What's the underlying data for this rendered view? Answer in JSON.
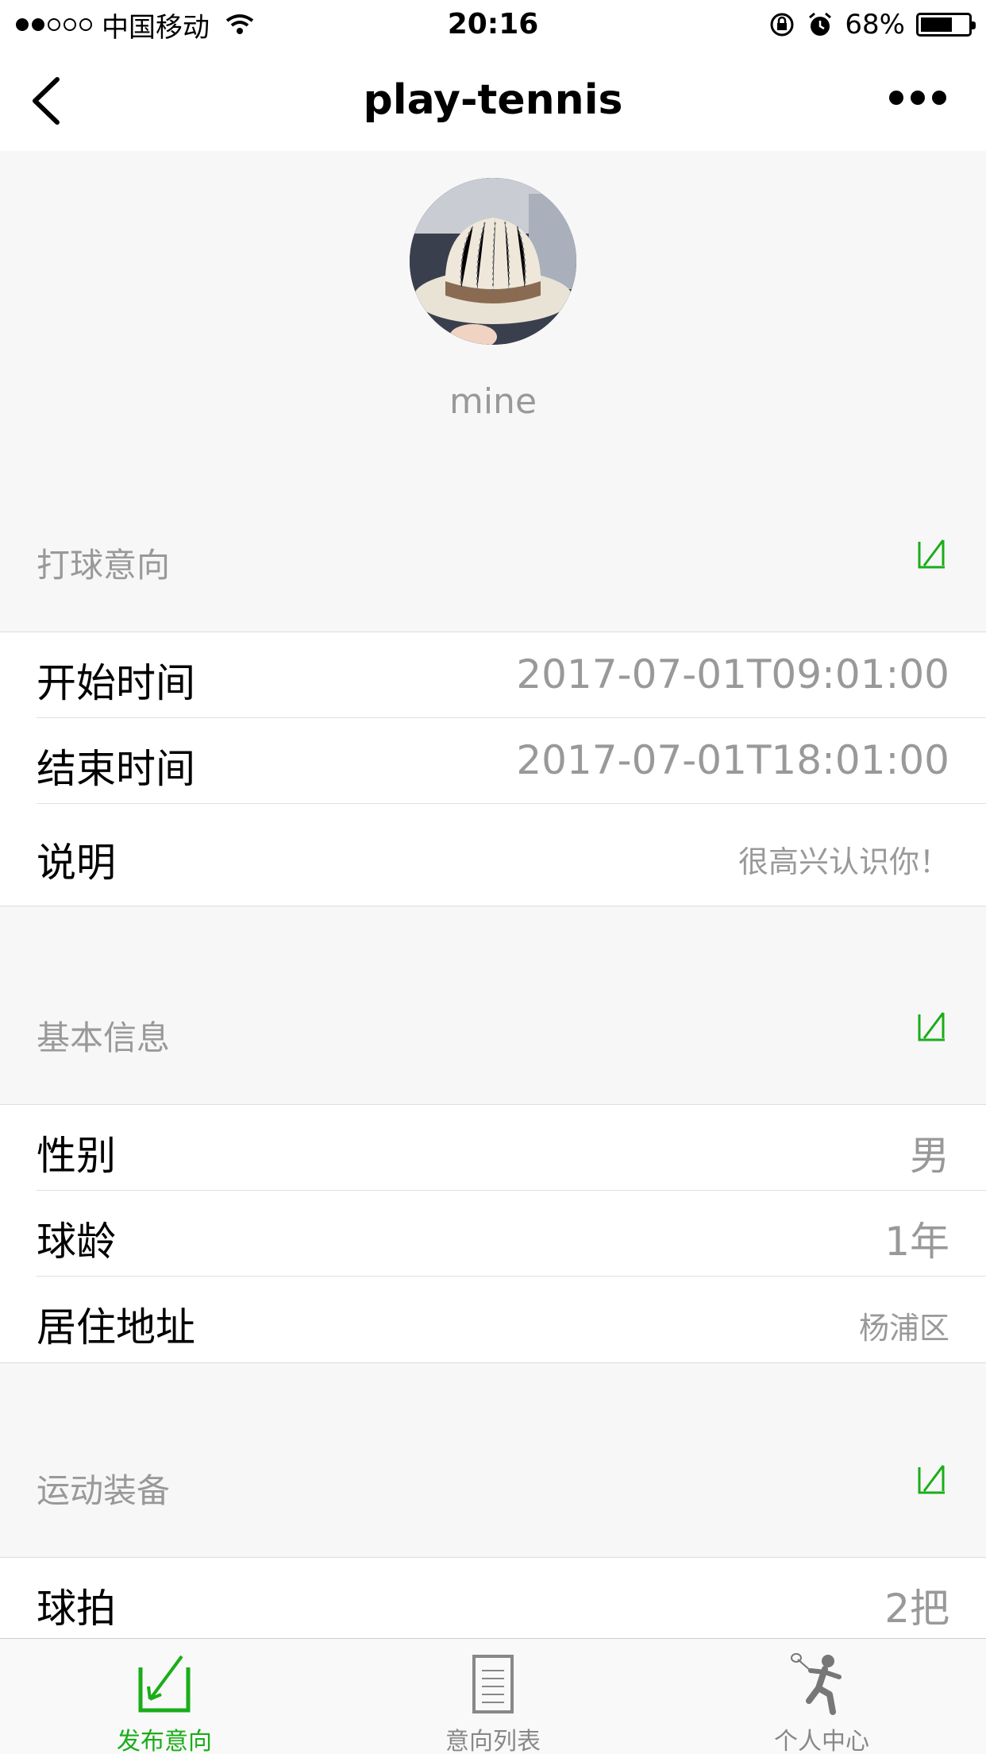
{
  "status_bar": {
    "carrier": "中国移动",
    "time": "20:16",
    "battery": "68%",
    "battery_level": 0.68
  },
  "nav": {
    "title": "play-tennis"
  },
  "profile": {
    "username": "mine"
  },
  "sections": [
    {
      "title": "打球意向",
      "rows": [
        {
          "label": "开始时间",
          "value": "2017-07-01T09:01:00"
        },
        {
          "label": "结束时间",
          "value": "2017-07-01T18:01:00"
        },
        {
          "label": "说明",
          "value": "很高兴认识你！"
        }
      ]
    },
    {
      "title": "基本信息",
      "rows": [
        {
          "label": "性别",
          "value": "男"
        },
        {
          "label": "球龄",
          "value": "1年"
        },
        {
          "label": "居住地址",
          "value": "杨浦区"
        }
      ]
    },
    {
      "title": "运动装备",
      "rows": [
        {
          "label": "球拍",
          "value": "2把"
        }
      ]
    }
  ],
  "tabs": [
    {
      "label": "发布意向",
      "icon": "publish-icon",
      "active": true
    },
    {
      "label": "意向列表",
      "icon": "list-icon",
      "active": false
    },
    {
      "label": "个人中心",
      "icon": "tennis-player-icon",
      "active": false
    }
  ],
  "colors": {
    "accent": "#1aad19",
    "muted_text": "#999999",
    "background": "#f7f7f7"
  }
}
